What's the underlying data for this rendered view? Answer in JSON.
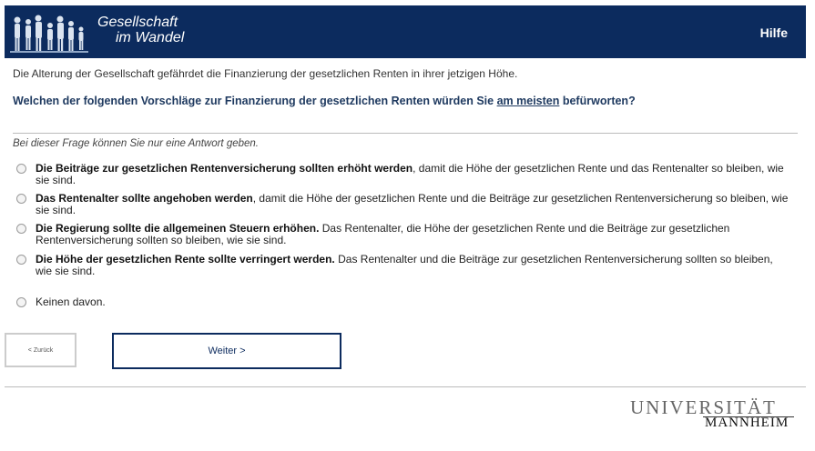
{
  "header": {
    "logo_line1": "Gesellschaft",
    "logo_line2": "im Wandel",
    "help_label": "Hilfe",
    "background": "#0c2b5e"
  },
  "intro": "Die Alterung der Gesellschaft gefährdet die Finanzierung der gesetzlichen Renten in ihrer jetzigen Höhe.",
  "question": {
    "before": "Welchen der folgenden Vorschläge zur Finanzierung der gesetzlichen Renten würden Sie ",
    "emphasis": "am meisten",
    "after": " befürworten?"
  },
  "hint": "Bei dieser Frage können Sie nur eine Antwort geben.",
  "options": [
    {
      "bold": "Die Beiträge zur gesetzlichen Rentenversicherung sollten erhöht werden",
      "rest": ", damit die Höhe der gesetzlichen Rente und das Rentenalter so bleiben, wie sie sind."
    },
    {
      "bold": "Das Rentenalter sollte angehoben werden",
      "rest": ", damit die Höhe der gesetzlichen Rente und die Beiträge zur gesetzlichen Rentenversicherung so bleiben, wie sie sind."
    },
    {
      "bold": "Die Regierung sollte die allgemeinen Steuern erhöhen.",
      "rest": " Das Rentenalter, die Höhe der gesetzlichen Rente und die Beiträge zur gesetzlichen Rentenversicherung sollten so bleiben, wie sie sind."
    },
    {
      "bold": "Die Höhe der gesetzlichen Rente sollte verringert werden.",
      "rest": " Das Rentenalter und die Beiträge zur gesetzlichen Rentenversicherung sollten so bleiben, wie sie sind."
    },
    {
      "bold": "",
      "rest": "Keinen davon."
    }
  ],
  "buttons": {
    "back": "< Zurück",
    "next": "Weiter >"
  },
  "footer": {
    "uni_line1": "UNIVERSITÄT",
    "uni_line2": "MANNHEIM"
  }
}
